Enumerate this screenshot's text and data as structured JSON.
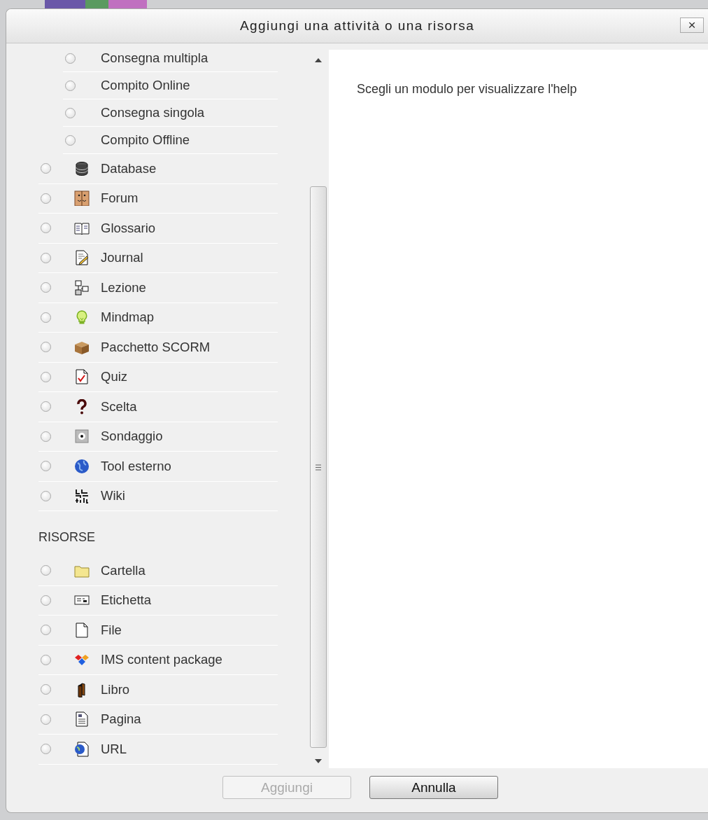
{
  "dialog": {
    "title": "Aggiungi una attività o una risorsa",
    "close": "×"
  },
  "activities": [
    {
      "kind": "subtype",
      "label": "Consegna multipla",
      "selected": false
    },
    {
      "kind": "subtype",
      "label": "Compito Online",
      "selected": false
    },
    {
      "kind": "subtype",
      "label": "Consegna singola",
      "selected": false
    },
    {
      "kind": "subtype",
      "label": "Compito Offline",
      "selected": false
    },
    {
      "kind": "module",
      "label": "Database",
      "selected": false
    },
    {
      "kind": "module",
      "label": "Forum",
      "selected": false
    },
    {
      "kind": "module",
      "label": "Glossario",
      "selected": false
    },
    {
      "kind": "module",
      "label": "Journal",
      "selected": false
    },
    {
      "kind": "module",
      "label": "Lezione",
      "selected": false
    },
    {
      "kind": "module",
      "label": "Mindmap",
      "selected": false
    },
    {
      "kind": "module",
      "label": "Pacchetto SCORM",
      "selected": false
    },
    {
      "kind": "module",
      "label": "Quiz",
      "selected": false
    },
    {
      "kind": "module",
      "label": "Scelta",
      "selected": false
    },
    {
      "kind": "module",
      "label": "Sondaggio",
      "selected": false
    },
    {
      "kind": "module",
      "label": "Tool esterno",
      "selected": false
    },
    {
      "kind": "module",
      "label": "Wiki",
      "selected": false
    }
  ],
  "resources": {
    "heading": "RISORSE",
    "items": [
      {
        "kind": "module",
        "label": "Cartella",
        "selected": false
      },
      {
        "kind": "module",
        "label": "Etichetta",
        "selected": false
      },
      {
        "kind": "module",
        "label": "File",
        "selected": false
      },
      {
        "kind": "module",
        "label": "IMS content package",
        "selected": false
      },
      {
        "kind": "module",
        "label": "Libro",
        "selected": false
      },
      {
        "kind": "module",
        "label": "Pagina",
        "selected": false
      },
      {
        "kind": "module",
        "label": "URL",
        "selected": false
      }
    ]
  },
  "help_text": "Scegli un modulo per visualizzare l'help",
  "buttons": [
    {
      "label": "Aggiungi",
      "disabled": true
    },
    {
      "label": "Annulla",
      "disabled": false
    }
  ]
}
